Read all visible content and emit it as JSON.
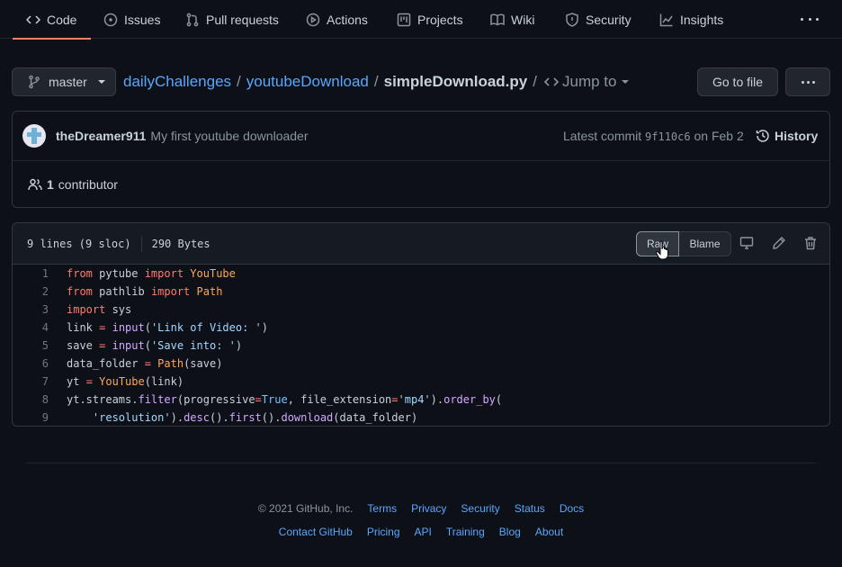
{
  "tabs": [
    {
      "label": "Code",
      "icon": "code-icon",
      "selected": true
    },
    {
      "label": "Issues",
      "icon": "issue-icon"
    },
    {
      "label": "Pull requests",
      "icon": "pull-request-icon"
    },
    {
      "label": "Actions",
      "icon": "play-icon"
    },
    {
      "label": "Projects",
      "icon": "project-icon"
    },
    {
      "label": "Wiki",
      "icon": "book-icon"
    },
    {
      "label": "Security",
      "icon": "shield-icon"
    },
    {
      "label": "Insights",
      "icon": "graph-icon"
    }
  ],
  "branch": "master",
  "breadcrumb": {
    "repo": "dailyChallenges",
    "folder": "youtubeDownload",
    "file": "simpleDownload.py",
    "separator": "/",
    "jump_to": "Jump to"
  },
  "go_to_file": "Go to file",
  "commit": {
    "author": "theDreamer911",
    "message": "My first youtube downloader",
    "latest_label": "Latest commit",
    "sha": "9f110c6",
    "date": "on Feb 2",
    "history": "History"
  },
  "contributors": {
    "count": "1",
    "label": "contributor"
  },
  "file": {
    "lines_info": "9 lines (9 sloc)",
    "size": "290 Bytes",
    "raw": "Raw",
    "blame": "Blame"
  },
  "code_lines": [
    "from pytube import YouTube",
    "from pathlib import Path",
    "import sys",
    "link = input('Link of Video: ')",
    "save = input('Save into: ')",
    "data_folder = Path(save)",
    "yt = YouTube(link)",
    "yt.streams.filter(progressive=True, file_extension='mp4').order_by(",
    "    'resolution').desc().first().download(data_folder)"
  ],
  "footer": {
    "copyright": "© 2021 GitHub, Inc.",
    "row1": [
      "Terms",
      "Privacy",
      "Security",
      "Status",
      "Docs"
    ],
    "row2": [
      "Contact GitHub",
      "Pricing",
      "API",
      "Training",
      "Blog",
      "About"
    ]
  },
  "colors": {
    "background": "#0d1117",
    "link": "#58a6ff",
    "selected_tab_underline": "#f78166",
    "keyword": "#ff7b72",
    "class_name": "#ffa657",
    "function": "#d2a8ff",
    "string": "#a5d6ff"
  }
}
